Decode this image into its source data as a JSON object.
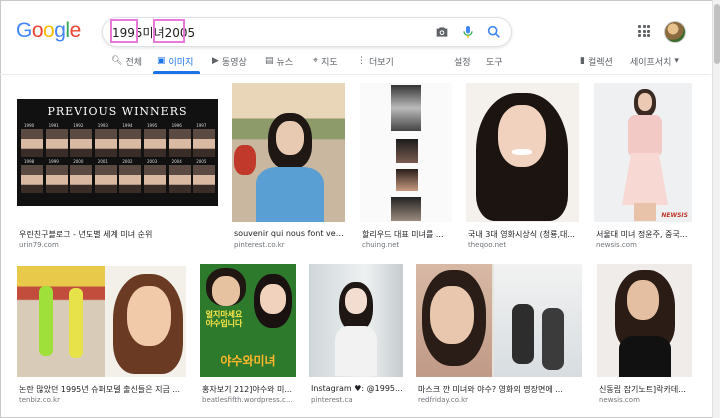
{
  "search": {
    "query": "1995미녀2005"
  },
  "logo": {
    "text": "Google",
    "colors": [
      "#4285f4",
      "#ea4335",
      "#fbbc05",
      "#4285f4",
      "#34a853",
      "#ea4335"
    ]
  },
  "highlight_color": "#e879d9",
  "tabs": [
    {
      "label": "전체",
      "icon": "search-icon"
    },
    {
      "label": "이미지",
      "icon": "image-icon",
      "active": true
    },
    {
      "label": "동영상",
      "icon": "video-icon"
    },
    {
      "label": "뉴스",
      "icon": "news-icon"
    },
    {
      "label": "지도",
      "icon": "map-pin-icon"
    },
    {
      "label": "더보기",
      "icon": "more-vert-icon"
    }
  ],
  "tools": {
    "settings": "설정",
    "tools": "도구",
    "collection": "컬렉션",
    "safesearch": "세이프서치"
  },
  "results": [
    {
      "title": "우린친구블로그 - 년도별 세계 미녀 순위",
      "domain": "urin79.com",
      "overlay": "PREVIOUS WINNERS"
    },
    {
      "title": "souvenir qui nous font veiller...",
      "domain": "pinterest.co.kr"
    },
    {
      "title": "할리우드 대표 미녀를 ...",
      "domain": "chuing.net"
    },
    {
      "title": "국내 3대 영화시상식 (청룡,대...",
      "domain": "theqoo.net"
    },
    {
      "title": "서울대 미녀 정윤주, 중국...",
      "domain": "newsis.com",
      "overlay": "NEWSIS"
    },
    {
      "title": "논란 많았던 1995년 슈퍼모델 출신들은 지금 ...",
      "domain": "tenbiz.co.kr"
    },
    {
      "title": "홍자보기 212]야수와 미...",
      "domain": "beatlesfifth.wordpress.c..."
    },
    {
      "title": "Instagram ♥: @1995...",
      "domain": "pinterest.ca"
    },
    {
      "title": "마스크 깐 미녀와 야수? 영화의 명장면에 ...",
      "domain": "redfriday.co.kr"
    },
    {
      "title": "신동립 잡기노트]락카데...",
      "domain": "newsis.com"
    }
  ],
  "poster_text": {
    "line1": "얼지마세요",
    "line2": "야수입니다",
    "title": "야수와미녀"
  },
  "winner_years": [
    "1990",
    "1991",
    "1992",
    "1993",
    "1994",
    "1995",
    "1996",
    "1997",
    "1998",
    "1999",
    "2000",
    "2001",
    "2002",
    "2003",
    "2004",
    "2005"
  ]
}
